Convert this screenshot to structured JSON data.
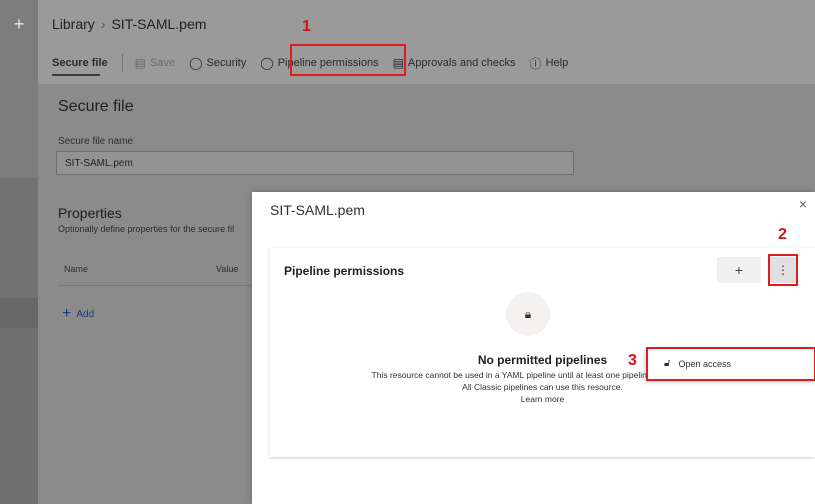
{
  "nav": {
    "new_icon": "+"
  },
  "breadcrumb": {
    "root": "Library",
    "separator": "›",
    "current": "SIT-SAML.pem"
  },
  "tabs": [
    {
      "label": "Secure file",
      "icon": ""
    },
    {
      "label": "Save",
      "icon": "save-icon"
    },
    {
      "label": "Security",
      "icon": "shield-icon"
    },
    {
      "label": "Pipeline permissions",
      "icon": "shield-icon"
    },
    {
      "label": "Approvals and checks",
      "icon": "checklist-icon"
    },
    {
      "label": "Help",
      "icon": "help-icon"
    }
  ],
  "annotations": {
    "one": "1",
    "two": "2",
    "three": "3"
  },
  "form": {
    "heading": "Secure file",
    "name_label": "Secure file name",
    "name_value": "SIT-SAML.pem",
    "properties_heading": "Properties",
    "properties_sub": "Optionally define properties for the secure fil",
    "col_name": "Name",
    "col_value": "Value",
    "add_label": "Add"
  },
  "dialog": {
    "title": "SIT-SAML.pem",
    "close": "×",
    "section_title": "Pipeline permissions",
    "add_button": "+",
    "more_button": "⋮",
    "empty_title": "No permitted pipelines",
    "empty_line1": "This resource cannot be used in a YAML pipeline until at least one pipeline has permission.",
    "empty_line2": "All Classic pipelines can use this resource.",
    "learn_more": "Learn more",
    "menu_item": "Open access"
  }
}
